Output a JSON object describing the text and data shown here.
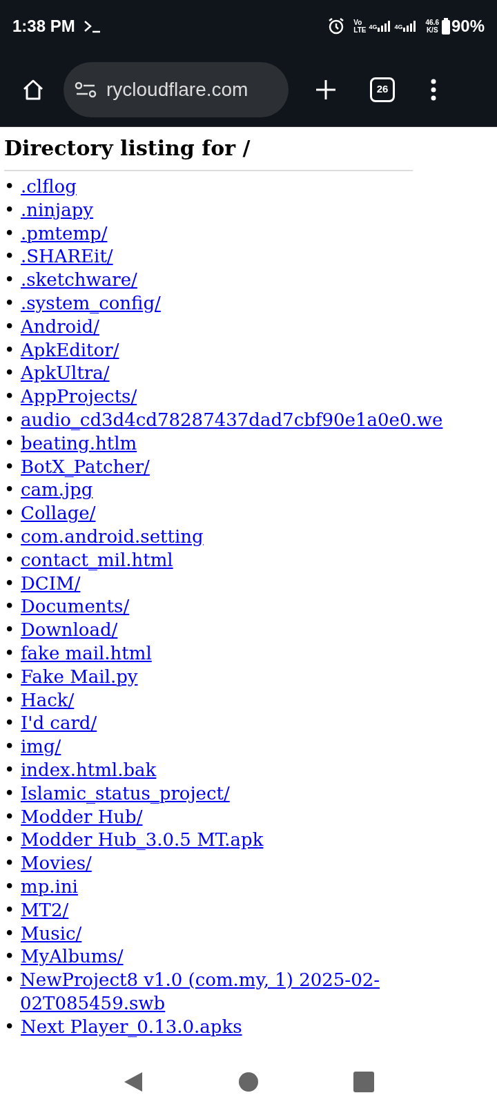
{
  "status_bar": {
    "time": "1:38 PM",
    "volte": [
      "Vo",
      "LTE"
    ],
    "sim_labels": [
      "4G",
      "4G"
    ],
    "net_speed": [
      "46.6",
      "K/S"
    ],
    "battery": "90%"
  },
  "toolbar": {
    "address": "rycloudflare.com",
    "tab_count": "26"
  },
  "page": {
    "heading": "Directory listing for /",
    "entries": [
      {
        "bullet": "•",
        "name": ".clflog"
      },
      {
        "bullet": "•",
        "name": ".ninjapy"
      },
      {
        "bullet": "•",
        "name": ".pmtemp/"
      },
      {
        "bullet": "•",
        "name": ".SHAREit/"
      },
      {
        "bullet": "•",
        "name": ".sketchware/"
      },
      {
        "bullet": "•",
        "name": ".system_config/"
      },
      {
        "bullet": "•",
        "name": "Android/"
      },
      {
        "bullet": "•",
        "name": "ApkEditor/"
      },
      {
        "bullet": "•",
        "name": "ApkUltra/"
      },
      {
        "bullet": "•",
        "name": "AppProjects/"
      },
      {
        "bullet": "•",
        "name": "audio_cd3d4cd78287437dad7cbf90e1a0e0.we"
      },
      {
        "bullet": "•",
        "name": "beating.htlm"
      },
      {
        "bullet": "•",
        "name": "BotX_Patcher/"
      },
      {
        "bullet": "•",
        "name": "cam.jpg"
      },
      {
        "bullet": "•",
        "name": "Collage/"
      },
      {
        "bullet": "•",
        "name": "com.android.setting"
      },
      {
        "bullet": "•",
        "name": "contact_mil.html"
      },
      {
        "bullet": "•",
        "name": "DCIM/"
      },
      {
        "bullet": "•",
        "name": "Documents/"
      },
      {
        "bullet": "•",
        "name": "Download/"
      },
      {
        "bullet": "•",
        "name": "fake mail.html"
      },
      {
        "bullet": "•",
        "name": "Fake Mail.py"
      },
      {
        "bullet": "•",
        "name": "Hack/"
      },
      {
        "bullet": "•",
        "name": "I'd card/"
      },
      {
        "bullet": "•",
        "name": "img/"
      },
      {
        "bullet": "•",
        "name": "index.html.bak"
      },
      {
        "bullet": "•",
        "name": "Islamic_status_project/"
      },
      {
        "bullet": "•",
        "name": "Modder Hub/"
      },
      {
        "bullet": "•",
        "name": "Modder Hub_3.0.5 MT.apk"
      },
      {
        "bullet": "•",
        "name": "Movies/"
      },
      {
        "bullet": "•",
        "name": "mp.ini"
      },
      {
        "bullet": "•",
        "name": "MT2/"
      },
      {
        "bullet": "•",
        "name": "Music/"
      },
      {
        "bullet": "•",
        "name": "MyAlbums/"
      },
      {
        "bullet": "•",
        "name": "NewProject8 v1.0 (com.my, 1) 2025-02-02T085459.swb"
      },
      {
        "bullet": "•",
        "name": "Next Player_0.13.0.apks"
      }
    ]
  }
}
